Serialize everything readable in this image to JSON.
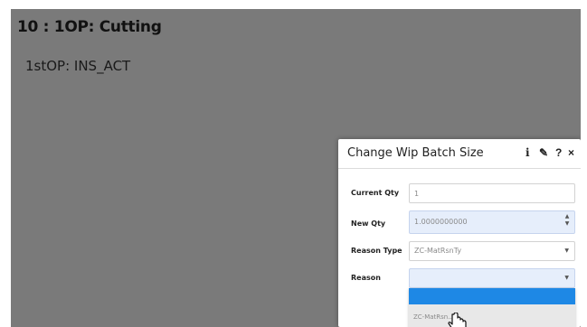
{
  "page": {
    "title": "10 : 1OP: Cutting",
    "operation": "1stOP: INS_ACT"
  },
  "dialog": {
    "title": "Change Wip Batch Size",
    "icons": {
      "info": "i",
      "edit": "✎",
      "help": "?",
      "close": "×"
    },
    "fields": {
      "current_qty": {
        "label": "Current Qty",
        "value": "1"
      },
      "new_qty": {
        "label": "New Qty",
        "value": "1.0000000000"
      },
      "reason_type": {
        "label": "Reason Type",
        "value": "ZC-MatRsnTy"
      },
      "reason": {
        "label": "Reason",
        "value": ""
      }
    },
    "dropdown": {
      "options": [
        "",
        "ZC-MatRsn..."
      ]
    }
  },
  "colors": {
    "backdrop": "#7a7a7a",
    "input_highlight": "#e6eefb",
    "option_selected": "#1e88e5",
    "option_hover": "#e8e8e8"
  }
}
